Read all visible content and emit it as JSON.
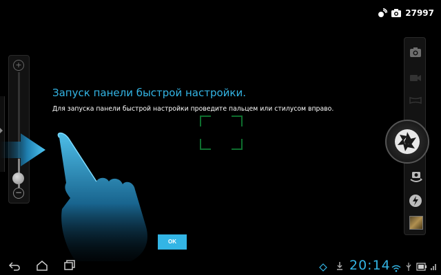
{
  "status_bar": {
    "photo_count": "27997",
    "icons": [
      "camera-mode-icon",
      "camera-icon"
    ]
  },
  "tutorial": {
    "title": "Запуск панели быстрой настройки.",
    "text": "Для запуска панели быстрой настройки проведите пальцем или стилусом вправо.",
    "ok_label": "OK"
  },
  "zoom": {
    "in_symbol": "+",
    "out_symbol": "−",
    "level": 0.1
  },
  "right_panel": {
    "icons": [
      "still-camera-icon",
      "video-camera-icon",
      "panorama-icon",
      "shutter-icon",
      "switch-camera-icon",
      "flash-icon",
      "gallery-thumbnail"
    ]
  },
  "nav_bar": {
    "time": "20:14",
    "icons": [
      "back-icon",
      "home-icon",
      "recent-apps-icon",
      "asus-diamond-icon",
      "download-icon",
      "wifi-icon",
      "battery-icon"
    ]
  },
  "colors": {
    "accent": "#33b5e5",
    "background": "#000000",
    "focus_bracket": "#0e6e2e"
  }
}
